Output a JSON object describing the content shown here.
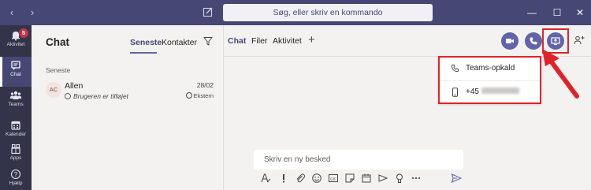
{
  "titlebar": {
    "search_placeholder": "Søg, eller skriv en kommando",
    "back_glyph": "‹",
    "forward_glyph": "›",
    "minimize_glyph": "—",
    "maximize_glyph": "☐",
    "close_glyph": "✕"
  },
  "rail": {
    "items": [
      {
        "label": "Aktivitet",
        "icon": "bell-icon",
        "badge": "5"
      },
      {
        "label": "Chat",
        "icon": "chat-icon",
        "active": true
      },
      {
        "label": "Teams",
        "icon": "teams-icon"
      },
      {
        "label": "Kalender",
        "icon": "calendar-icon"
      },
      {
        "label": "Apps",
        "icon": "apps-icon"
      },
      {
        "label": "Hjælp",
        "icon": "help-icon"
      }
    ]
  },
  "chat_list": {
    "title": "Chat",
    "tabs": [
      "Seneste",
      "Kontakter"
    ],
    "section_label": "Seneste",
    "rows": [
      {
        "initials": "AC",
        "name": "Allen",
        "subtitle": "Brugeren er tilføjet",
        "date": "28/02",
        "tag": "Ekstern"
      }
    ]
  },
  "main": {
    "tabs": [
      "Chat",
      "Filer",
      "Aktivitet"
    ],
    "add_tab_glyph": "+",
    "call_menu": {
      "items": [
        {
          "label": "Teams-opkald",
          "icon": "phone-icon"
        },
        {
          "label": "+45",
          "icon": "mobile-icon"
        }
      ]
    },
    "compose_placeholder": "Skriv en ny besked",
    "compose_tools": [
      "format-icon",
      "important-icon",
      "attach-icon",
      "emoji-icon",
      "gif-icon",
      "sticker-icon",
      "schedule-meeting-icon",
      "stream-icon",
      "praise-icon",
      "more-icon"
    ]
  },
  "colors": {
    "titlebar": "#464775",
    "rail": "#33344a",
    "accent": "#6264a7",
    "highlight": "#e02329",
    "badge": "#c4314b"
  }
}
